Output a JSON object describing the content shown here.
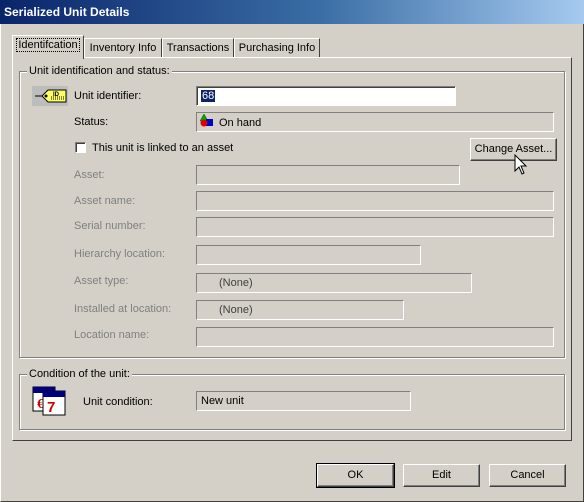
{
  "window": {
    "title": "Serialized Unit Details"
  },
  "tabs": [
    {
      "label": "Identifcation",
      "active": true
    },
    {
      "label": "Inventory Info",
      "active": false
    },
    {
      "label": "Transactions",
      "active": false
    },
    {
      "label": "Purchasing Info",
      "active": false
    }
  ],
  "unit_group": {
    "legend": "Unit identification and status:",
    "unit_identifier": {
      "label": "Unit identifier:",
      "value": "68"
    },
    "status": {
      "label": "Status:",
      "value": "On hand"
    },
    "linked_checkbox": {
      "label": "This unit is linked to an asset",
      "checked": false
    },
    "change_asset_button": "Change Asset...",
    "asset": {
      "label": "Asset:",
      "value": ""
    },
    "asset_name": {
      "label": "Asset name:",
      "value": ""
    },
    "serial_number": {
      "label": "Serial number:",
      "value": ""
    },
    "hierarchy_location": {
      "label": "Hierarchy location:",
      "value": ""
    },
    "asset_type": {
      "label": "Asset type:",
      "value": "(None)"
    },
    "installed_at_location": {
      "label": "Installed at location:",
      "value": "(None)"
    },
    "location_name": {
      "label": "Location name:",
      "value": ""
    }
  },
  "condition_group": {
    "legend": "Condition of the unit:",
    "unit_condition": {
      "label": "Unit condition:",
      "value": "New unit"
    }
  },
  "footer": {
    "ok": "OK",
    "edit": "Edit",
    "cancel": "Cancel"
  },
  "icons": {
    "tag": "id-tag-icon",
    "status": "status-shapes-icon",
    "condition": "calendar-icon",
    "cursor": "mouse-pointer-icon"
  }
}
